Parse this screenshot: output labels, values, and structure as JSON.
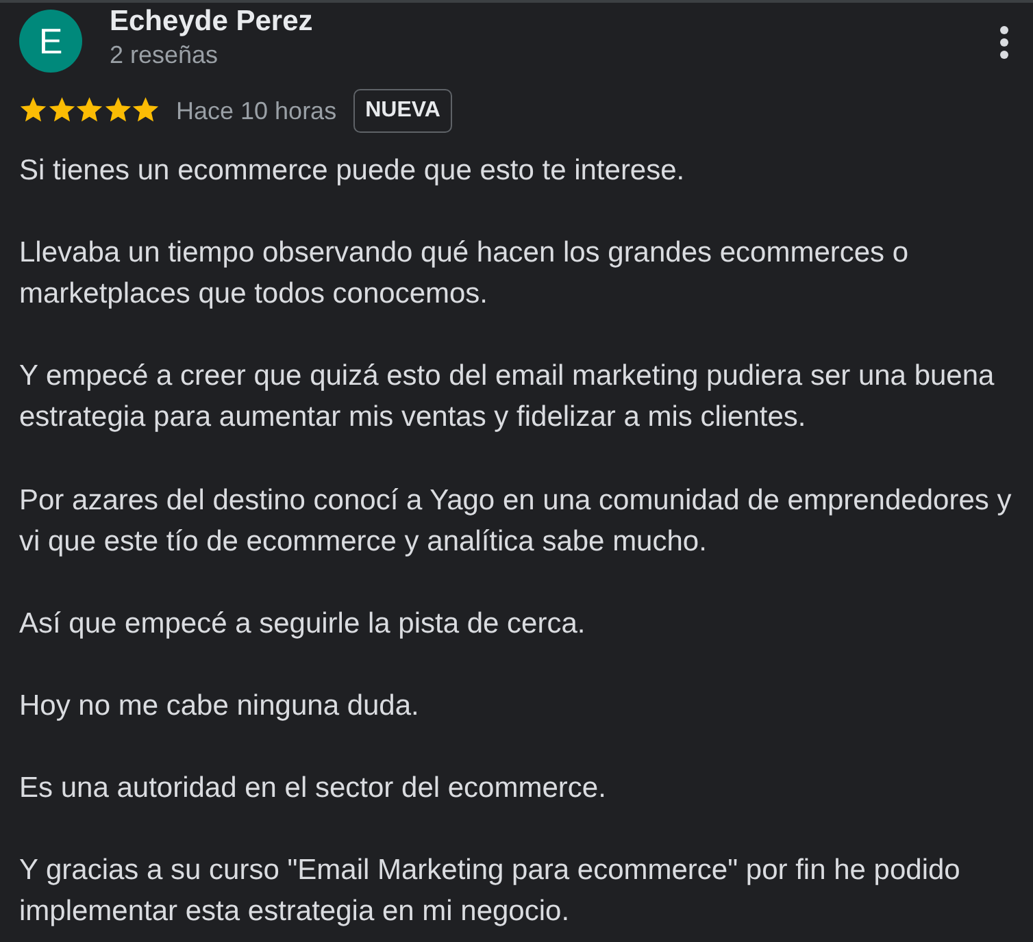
{
  "reviewer": {
    "initial": "E",
    "name": "Echeyde Perez",
    "reviews": "2 reseñas"
  },
  "rating": {
    "stars": 5,
    "time": "Hace 10 horas",
    "badge": "NUEVA"
  },
  "paragraphs": [
    "Si tienes un ecommerce puede que esto te interese.",
    "Llevaba un tiempo observando qué hacen los grandes ecommerces o marketplaces que todos conocemos.",
    "Y empecé a creer que quizá esto del email marketing pudiera ser una buena estrategia para aumentar mis ventas y fidelizar a mis clientes.",
    "Por azares del destino conocí a Yago en una comunidad de emprendedores y vi que este tío de ecommerce y analítica sabe mucho.",
    "Así que empecé a seguirle la pista de cerca.",
    "Hoy no me cabe ninguna duda.",
    "Es una autoridad en el sector del ecommerce.",
    "Y gracias a su curso \"Email Marketing para ecommerce\" por fin he podido implementar esta estrategia en mi negocio."
  ]
}
